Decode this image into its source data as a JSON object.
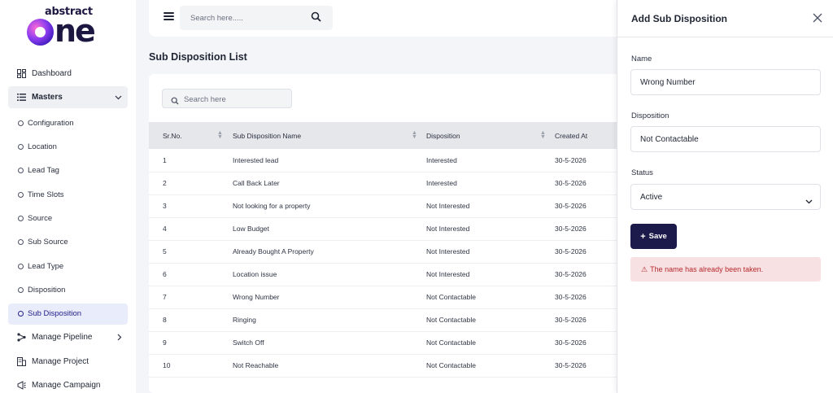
{
  "logo": {
    "small": "abstract",
    "big": "ne"
  },
  "sidebar": {
    "items": [
      {
        "label": "Dashboard",
        "icon": "dashboard-icon"
      },
      {
        "label": "Masters",
        "icon": "list-icon"
      },
      {
        "label": "Configuration"
      },
      {
        "label": "Location"
      },
      {
        "label": "Lead Tag"
      },
      {
        "label": "Time Slots"
      },
      {
        "label": "Source"
      },
      {
        "label": "Sub Source"
      },
      {
        "label": "Lead Type"
      },
      {
        "label": "Disposition"
      },
      {
        "label": "Sub Disposition",
        "active": true
      },
      {
        "label": "Manage Pipeline",
        "icon": "pipeline-icon"
      },
      {
        "label": "Manage Project",
        "icon": "building-icon"
      },
      {
        "label": "Manage Campaign",
        "icon": "campaign-icon"
      }
    ]
  },
  "header": {
    "search_placeholder": "Search here....."
  },
  "page": {
    "title": "Sub Disposition List",
    "search_placeholder": "Search here",
    "columns": [
      "Sr.No.",
      "Sub Disposition Name",
      "Disposition",
      "Created At"
    ],
    "rows": [
      [
        "1",
        "Interested lead",
        "Interested",
        "30-5-2026"
      ],
      [
        "2",
        "Call Back Later",
        "Interested",
        "30-5-2026"
      ],
      [
        "3",
        "Not looking for a property",
        "Not Interested",
        "30-5-2026"
      ],
      [
        "4",
        "Low Budget",
        "Not Interested",
        "30-5-2026"
      ],
      [
        "5",
        "Already Bought A Property",
        "Not Interested",
        "30-5-2026"
      ],
      [
        "6",
        "Location issue",
        "Not Interested",
        "30-5-2026"
      ],
      [
        "7",
        "Wrong Number",
        "Not Contactable",
        "30-5-2026"
      ],
      [
        "8",
        "Ringing",
        "Not Contactable",
        "30-5-2026"
      ],
      [
        "9",
        "Switch Off",
        "Not Contactable",
        "30-5-2026"
      ],
      [
        "10",
        "Not Reachable",
        "Not Contactable",
        "30-5-2026"
      ]
    ]
  },
  "drawer": {
    "title": "Add Sub Disposition",
    "name_label": "Name",
    "name_value": "Wrong Number",
    "disposition_label": "Disposition",
    "disposition_value": "Not Contactable",
    "status_label": "Status",
    "status_value": "Active",
    "save_label": "Save",
    "error": "The name has already been taken."
  },
  "colors": {
    "primary": "#1b1a4a",
    "error_bg": "#f8e1e2",
    "error_text": "#b4282d",
    "active_bg": "#e9ecfb"
  }
}
